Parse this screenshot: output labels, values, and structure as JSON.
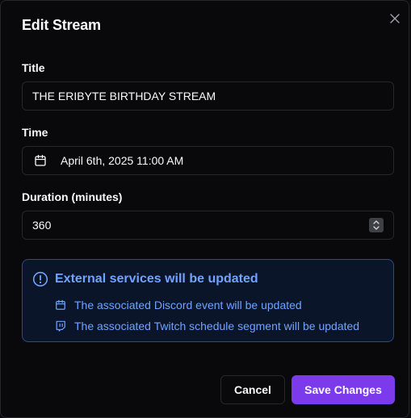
{
  "dialog": {
    "title": "Edit Stream",
    "close_icon": "close-icon"
  },
  "form": {
    "title_label": "Title",
    "title_value": "THE ERIBYTE BIRTHDAY STREAM",
    "time_label": "Time",
    "time_value": "April 6th, 2025 11:00 AM",
    "time_icon": "calendar-icon",
    "duration_label": "Duration (minutes)",
    "duration_value": "360"
  },
  "alert": {
    "icon": "info-circle-icon",
    "title": "External services will be updated",
    "items": [
      {
        "icon": "calendar-icon",
        "text": "The associated Discord event will be updated"
      },
      {
        "icon": "twitch-icon",
        "text": "The associated Twitch schedule segment will be updated"
      }
    ]
  },
  "actions": {
    "cancel_label": "Cancel",
    "save_label": "Save Changes"
  },
  "colors": {
    "background": "#09090b",
    "border": "#27272a",
    "accent": "#7c3aed",
    "info": "#6fa3ff",
    "info_border": "#2b4b8f"
  }
}
